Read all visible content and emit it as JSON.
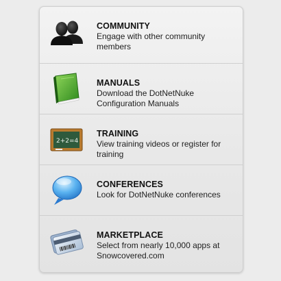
{
  "items": [
    {
      "title": "COMMUNITY",
      "description": "Engage with other community members",
      "icon": "community-icon"
    },
    {
      "title": "MANUALS",
      "description": "Download the DotNetNuke Configuration Manuals",
      "icon": "book-icon"
    },
    {
      "title": "TRAINING",
      "description": "View training videos or register for training",
      "icon": "chalkboard-icon"
    },
    {
      "title": "CONFERENCES",
      "description": "Look for DotNetNuke conferences",
      "icon": "speech-bubble-icon"
    },
    {
      "title": "MARKETPLACE",
      "description": "Select from nearly 10,000 apps at Snowcovered.com",
      "icon": "credit-card-icon"
    }
  ]
}
